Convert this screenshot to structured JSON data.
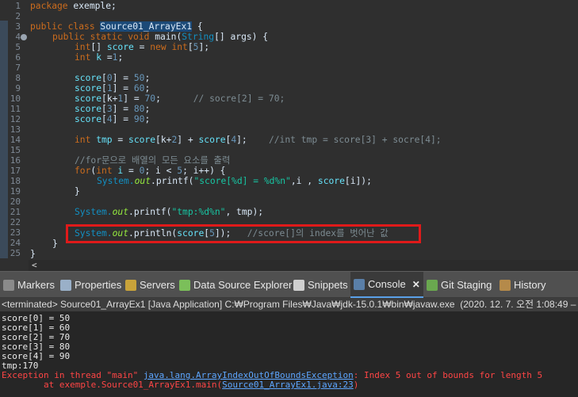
{
  "editor": {
    "line_numbers": [
      "1",
      "2",
      "3",
      "4",
      "5",
      "6",
      "7",
      "8",
      "9",
      "10",
      "11",
      "12",
      "13",
      "14",
      "15",
      "16",
      "17",
      "18",
      "19",
      "20",
      "21",
      "22",
      "23",
      "24",
      "25"
    ],
    "lines": {
      "l1_a": "package",
      "l1_b": " exemple;",
      "l3_a": "public class ",
      "l3_b": "Source01_ArrayEx1",
      "l3_c": " {",
      "l4_a": "public static void ",
      "l4_b": "main(",
      "l4_c": "String",
      "l4_d": "[] args) {",
      "l5_a": "int",
      "l5_b": "[] ",
      "l5_c": "score",
      "l5_d": " = ",
      "l5_e": "new",
      "l5_f": " int",
      "l5_g": "[",
      "l5_h": "5",
      "l5_i": "];",
      "l6_a": "int",
      "l6_b": " k",
      "l6_c": " =",
      "l6_d": "1",
      "l6_e": ";",
      "l9_a": "score",
      "l9_b": "[",
      "l9_c": "0",
      "l9_d": "] = ",
      "l9_e": "50",
      "l9_f": ";",
      "l10_a": "score",
      "l10_b": "[",
      "l10_c": "1",
      "l10_d": "] = ",
      "l10_e": "60",
      "l10_f": ";",
      "l11_a": "score",
      "l11_b": "[k+",
      "l11_c": "1",
      "l11_d": "] = ",
      "l11_e": "70",
      "l11_f": ";",
      "l11_g": "// socre[2] = 70;",
      "l12_a": "score",
      "l12_b": "[",
      "l12_c": "3",
      "l12_d": "] = ",
      "l12_e": "80",
      "l12_f": ";",
      "l13_a": "score",
      "l13_b": "[",
      "l13_c": "4",
      "l13_d": "] = ",
      "l13_e": "90",
      "l13_f": ";",
      "l15_a": "int",
      "l15_b": " tmp",
      "l15_c": " = ",
      "l15_d": "score",
      "l15_e": "[k+",
      "l15_f": "2",
      "l15_g": "] + ",
      "l15_h": "score",
      "l15_i": "[",
      "l15_j": "4",
      "l15_k": "];",
      "l15_l": "//int tmp = score[3] + socre[4];",
      "l17": "//for문으로 배열의 모든 요소를 출력",
      "l18_a": "for",
      "l18_b": "(",
      "l18_c": "int",
      "l18_d": " i",
      "l18_e": " = ",
      "l18_f": "0",
      "l18_g": "; i < ",
      "l18_h": "5",
      "l18_i": "; i++) {",
      "l19_a": "System.",
      "l19_b": "out",
      "l19_c": ".printf(",
      "l19_d": "\"score[%d] = %d%n\"",
      "l19_e": ",i , ",
      "l19_f": "score",
      "l19_g": "[i]);",
      "l20": "}",
      "l22_a": "System.",
      "l22_b": "out",
      "l22_c": ".printf(",
      "l22_d": "\"tmp:%d%n\"",
      "l22_e": ", tmp);",
      "l24_a": "System.",
      "l24_b": "out",
      "l24_c": ".println(",
      "l24_d": "score",
      "l24_e": "[",
      "l24_f": "5",
      "l24_g": "]);",
      "l24_h": "//score[]의 index를 벗어난 값",
      "l25": "}",
      "l26": "}"
    },
    "scroll_arrow": "<"
  },
  "tabs": [
    {
      "label": "Markers",
      "icon": "markers-icon"
    },
    {
      "label": "Properties",
      "icon": "properties-icon"
    },
    {
      "label": "Servers",
      "icon": "servers-icon"
    },
    {
      "label": "Data Source Explorer",
      "icon": "data-source-icon"
    },
    {
      "label": "Snippets",
      "icon": "snippets-icon"
    },
    {
      "label": "Console",
      "icon": "console-icon"
    },
    {
      "label": "Git Staging",
      "icon": "git-staging-icon"
    },
    {
      "label": "History",
      "icon": "history-icon"
    }
  ],
  "console_close": "✕",
  "console": {
    "header": "<terminated> Source01_ArrayEx1 [Java Application] C:₩Program Files₩Java₩jdk-15.0.1₩bin₩javaw.exe  (2020. 12. 7. 오전 1:08:49 – 오",
    "output": [
      "score[0] = 50",
      "score[1] = 60",
      "score[2] = 70",
      "score[3] = 80",
      "score[4] = 90",
      "tmp:170"
    ],
    "err1_a": "Exception in thread \"main\" ",
    "err1_b": "java.lang.ArrayIndexOutOfBoundsException",
    "err1_c": ": Index 5 out of bounds for length 5",
    "err2_a": "        at exemple.Source01_ArrayEx1.main(",
    "err2_b": "Source01_ArrayEx1.java:23",
    "err2_c": ")"
  },
  "colors": {
    "keyword": "#cc6c1d",
    "type": "#1290c3",
    "field": "#66e1f8",
    "string": "#17c6a3",
    "static_field": "#96ec3f",
    "comment": "#7d8c93",
    "error": "#ff4545",
    "highlight_box": "#e01a1a"
  }
}
